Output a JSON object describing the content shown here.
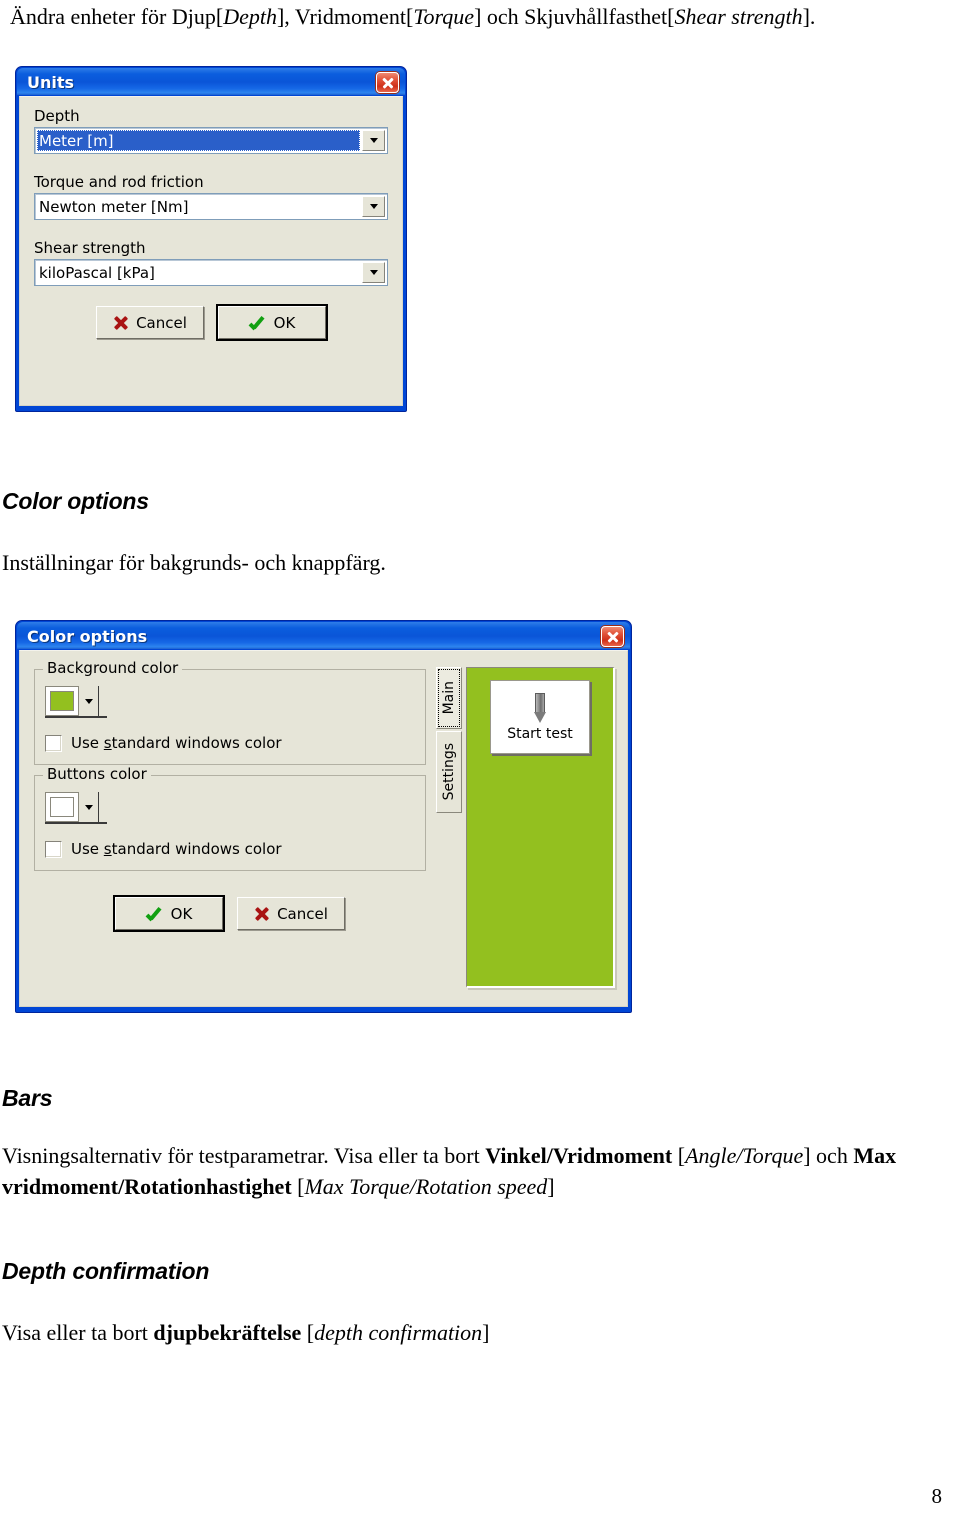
{
  "document": {
    "intro_segments": [
      {
        "text": "Ändra enheter för Djup[",
        "italic": false
      },
      {
        "text": "Depth",
        "italic": true
      },
      {
        "text": "], Vridmoment[",
        "italic": false
      },
      {
        "text": "Torque",
        "italic": true
      },
      {
        "text": "] och Skjuvhållfasthet[",
        "italic": false
      },
      {
        "text": "Shear strength",
        "italic": true
      },
      {
        "text": "].",
        "italic": false
      }
    ],
    "sections": {
      "color_options": {
        "heading": "Color options",
        "paragraph": [
          {
            "text": "Inställningar för bakgrunds- och knappfärg.",
            "style": "normal"
          }
        ]
      },
      "bars": {
        "heading": "Bars",
        "paragraph": [
          {
            "text": "Visningsalternativ för testparametrar. Visa eller ta bort ",
            "style": "normal"
          },
          {
            "text": "Vinkel/Vridmoment",
            "style": "bold"
          },
          {
            "text": " [",
            "style": "normal"
          },
          {
            "text": "Angle/Torque",
            "style": "italic"
          },
          {
            "text": "] och ",
            "style": "normal"
          },
          {
            "text": "Max vridmoment/Rotationhastighet",
            "style": "bold"
          },
          {
            "text": " [",
            "style": "normal"
          },
          {
            "text": "Max Torque/Rotation speed",
            "style": "italic"
          },
          {
            "text": "]",
            "style": "normal"
          }
        ]
      },
      "depth_confirmation": {
        "heading": "Depth confirmation",
        "paragraph": [
          {
            "text": "Visa eller ta bort ",
            "style": "normal"
          },
          {
            "text": "djupbekräftelse",
            "style": "bold"
          },
          {
            "text": " [",
            "style": "normal"
          },
          {
            "text": "depth confirmation",
            "style": "italic"
          },
          {
            "text": "]",
            "style": "normal"
          }
        ]
      }
    },
    "page_number": "8"
  },
  "units_dialog": {
    "title": "Units",
    "close_icon": "close-icon",
    "fields": [
      {
        "label": "Depth",
        "value": "Meter [m]",
        "selected": true
      },
      {
        "label": "Torque and rod friction",
        "value": "Newton meter [Nm]",
        "selected": false
      },
      {
        "label": "Shear strength",
        "value": "kiloPascal [kPa]",
        "selected": false
      }
    ],
    "buttons": [
      {
        "label": "Cancel",
        "icon": "red-x-icon",
        "default": false
      },
      {
        "label": "OK",
        "icon": "green-check-icon",
        "default": true
      }
    ]
  },
  "color_options_dialog": {
    "title": "Color options",
    "close_icon": "close-icon",
    "groups": [
      {
        "title": "Background color",
        "swatch_color": "#93c01f",
        "checkbox_label_pre": "Use ",
        "checkbox_label_accel": "s",
        "checkbox_label_post": "tandard windows color",
        "checkbox_checked": false
      },
      {
        "title": "Buttons color",
        "swatch_color": "#ffffff",
        "checkbox_label_pre": "Use ",
        "checkbox_label_accel": "s",
        "checkbox_label_post": "tandard windows color",
        "checkbox_checked": false
      }
    ],
    "buttons": [
      {
        "label": "OK",
        "icon": "green-check-icon",
        "default": true
      },
      {
        "label": "Cancel",
        "icon": "red-x-icon",
        "default": false
      }
    ],
    "preview": {
      "tabs": [
        {
          "label": "Main",
          "active": true
        },
        {
          "label": "Settings",
          "active": false
        }
      ],
      "background_color": "#93c01f",
      "start_test": {
        "label": "Start test",
        "icon": "sounding-probe-icon"
      }
    }
  },
  "colors": {
    "title_blue": "#0b5ede",
    "dialog_face": "#e6e5d8",
    "preview_green": "#93c01f",
    "selection_blue": "#2a5fc9",
    "close_red": "#cf3019",
    "check_green": "#11a011",
    "x_red": "#a91313"
  }
}
